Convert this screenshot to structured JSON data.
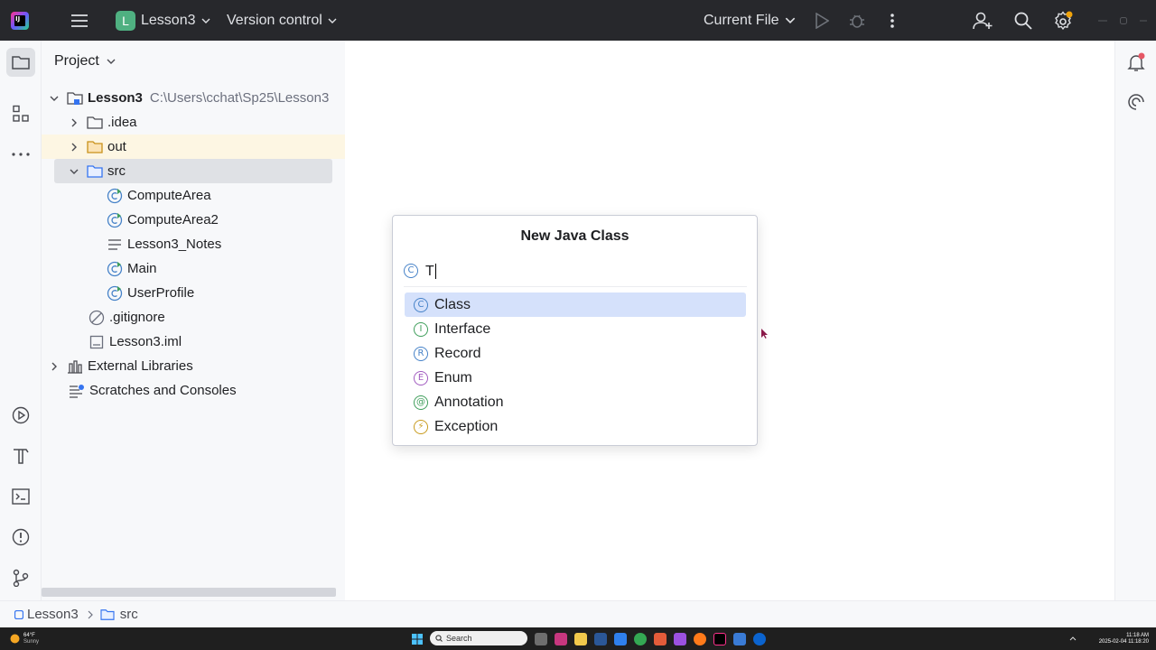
{
  "titlebar": {
    "project_initial": "L",
    "project_name": "Lesson3",
    "vcs_label": "Version control",
    "run_config": "Current File"
  },
  "panel": {
    "title": "Project",
    "tree": [
      {
        "label": "Lesson3",
        "path": "C:\\Users\\cchat\\Sp25\\Lesson3"
      },
      {
        "label": ".idea"
      },
      {
        "label": "out"
      },
      {
        "label": "src"
      },
      {
        "label": "ComputeArea"
      },
      {
        "label": "ComputeArea2"
      },
      {
        "label": "Lesson3_Notes"
      },
      {
        "label": "Main"
      },
      {
        "label": "UserProfile"
      },
      {
        "label": ".gitignore"
      },
      {
        "label": "Lesson3.iml"
      },
      {
        "label": "External Libraries"
      },
      {
        "label": "Scratches and Consoles"
      }
    ]
  },
  "popup": {
    "title": "New Java Class",
    "input_value": "T",
    "options": [
      {
        "label": "Class",
        "letter": "C",
        "color": "#4682c8"
      },
      {
        "label": "Interface",
        "letter": "I",
        "color": "#3f9e5b"
      },
      {
        "label": "Record",
        "letter": "R",
        "color": "#4682c8"
      },
      {
        "label": "Enum",
        "letter": "E",
        "color": "#a15bc0"
      },
      {
        "label": "Annotation",
        "letter": "@",
        "color": "#3f9e5b"
      },
      {
        "label": "Exception",
        "letter": "⚡",
        "color": "#c89b1e"
      }
    ]
  },
  "statusbar": {
    "crumbs": [
      "Lesson3",
      "src"
    ]
  },
  "taskbar": {
    "weather_temp": "64°F",
    "weather_text": "Sunny",
    "search_placeholder": "Search",
    "time": "11:18 AM",
    "datetime": "2025-02-04 11:18:20"
  },
  "colors": {
    "titlebar_bg": "#27282c",
    "selection": "#d5e1fb",
    "highlight_row": "#fdf6e3",
    "selected_row": "#dfe1e5"
  }
}
